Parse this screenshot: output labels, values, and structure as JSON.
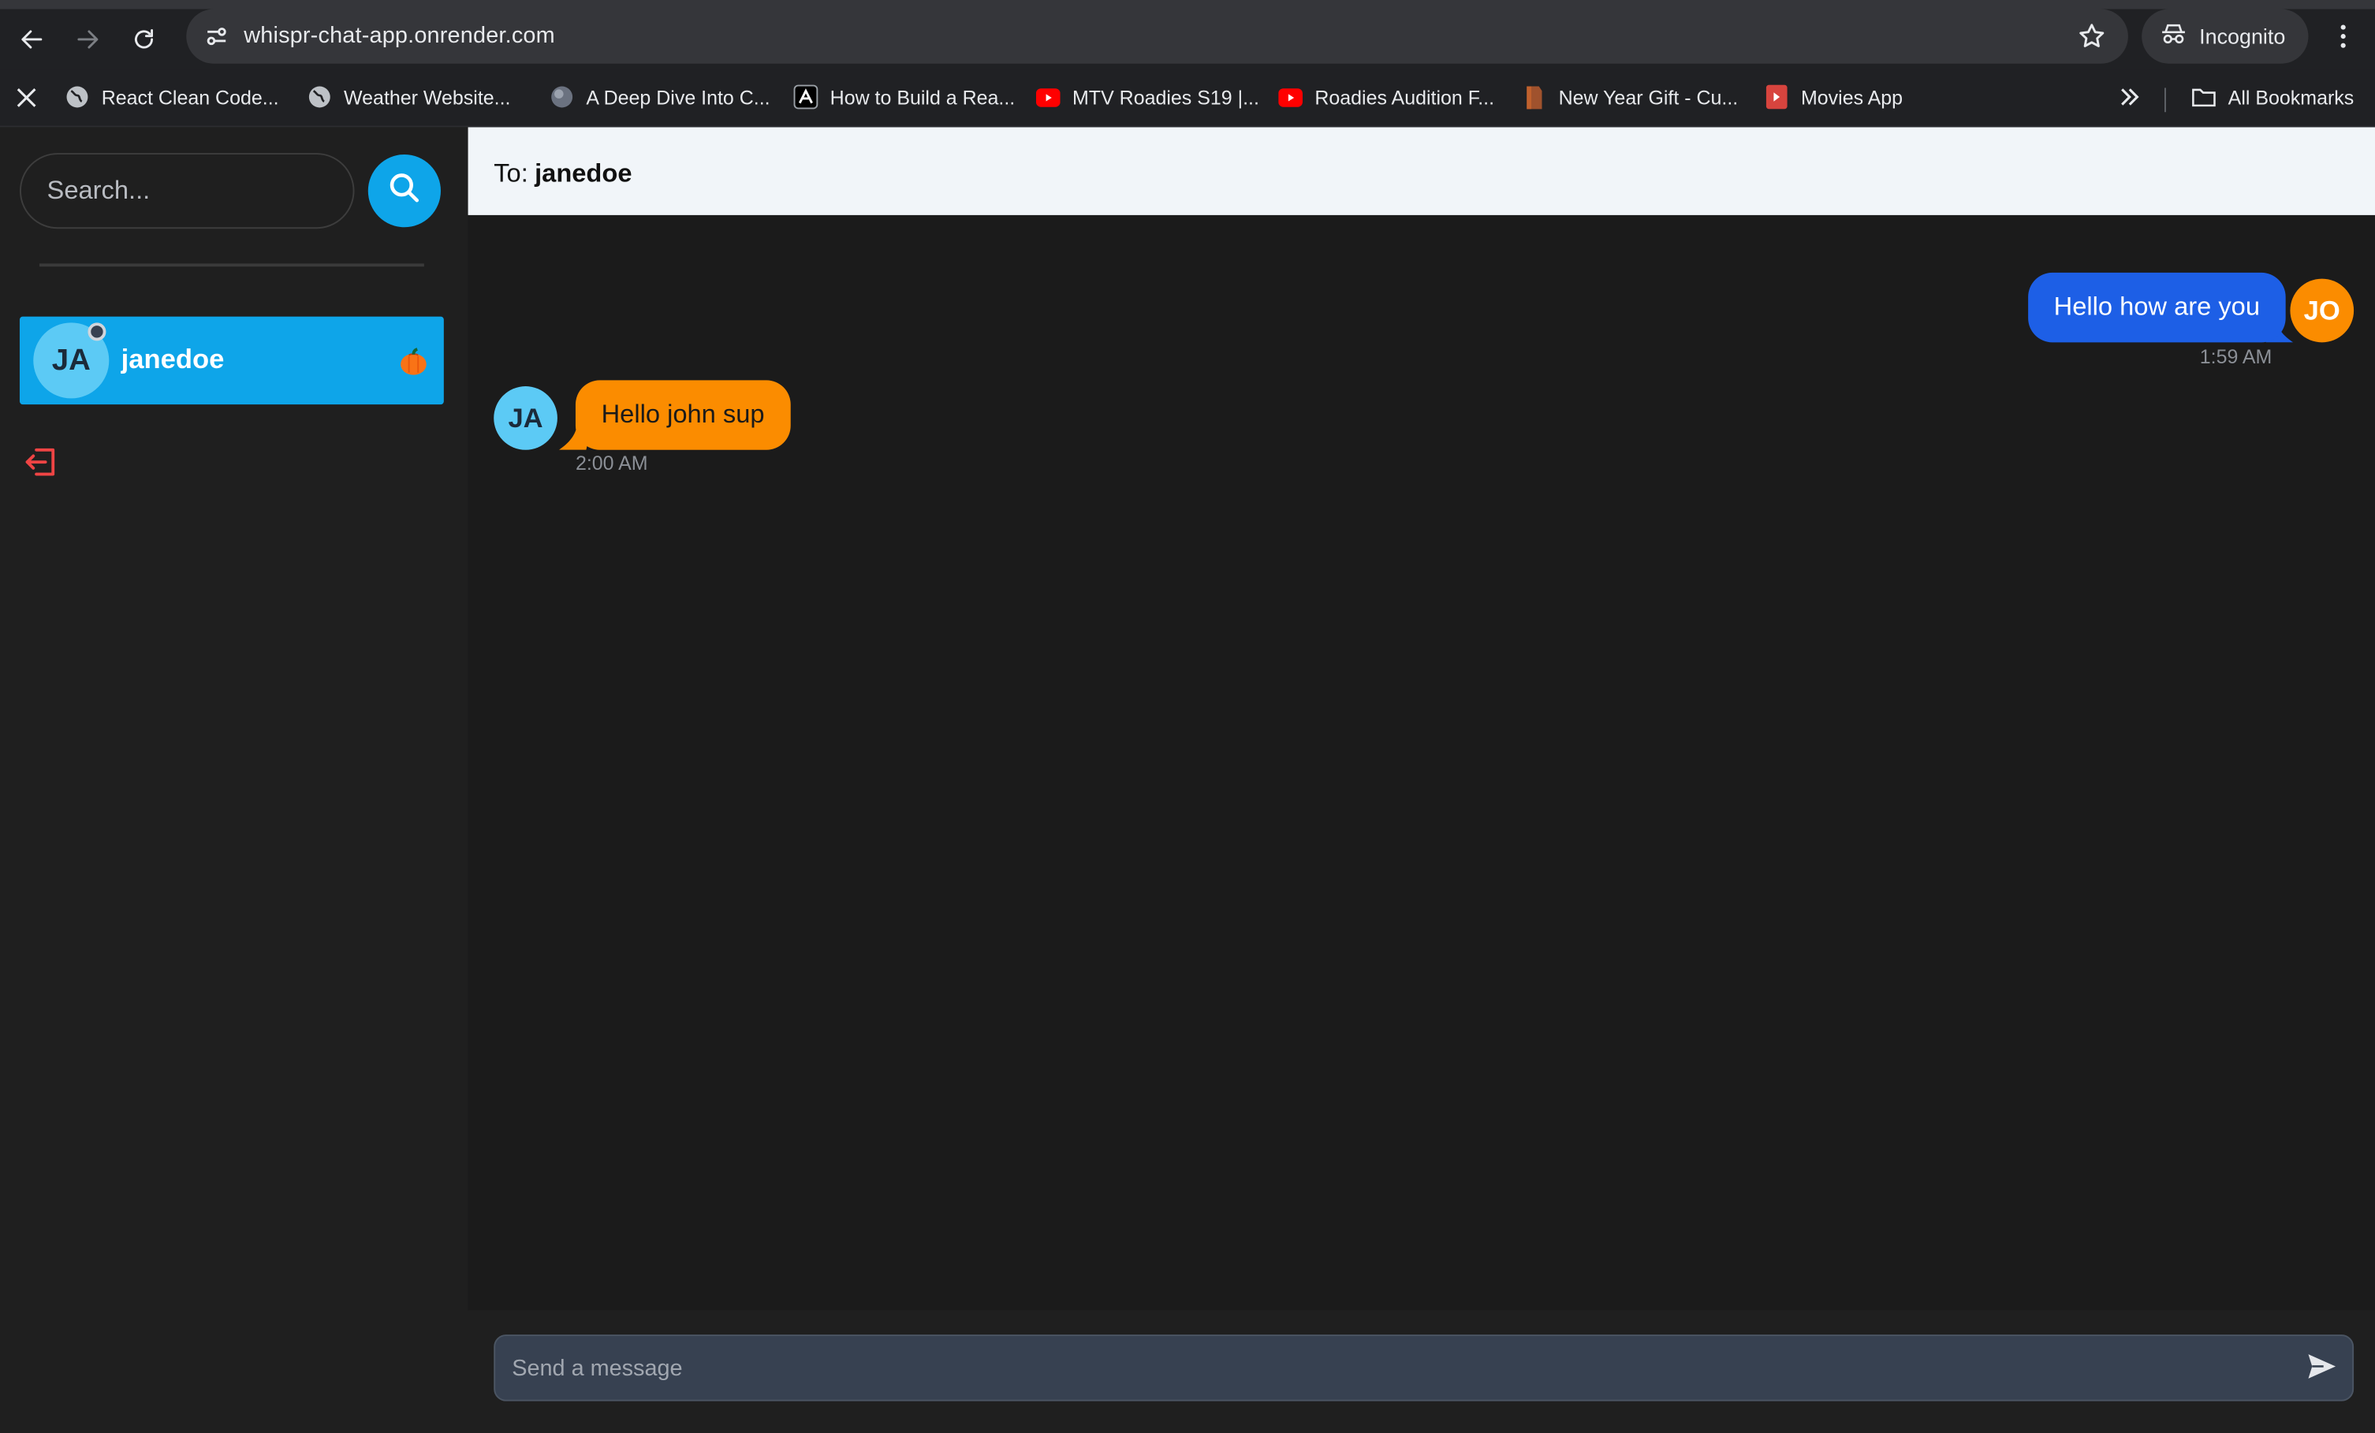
{
  "browser": {
    "url": "whispr-chat-app.onrender.com",
    "profile_label": "Incognito",
    "bookmarks": [
      {
        "label": "React Clean Code...",
        "icon": "globe-icon"
      },
      {
        "label": "Weather Website...",
        "icon": "globe-icon"
      },
      {
        "label": "A Deep Dive Into C...",
        "icon": "planet-icon"
      },
      {
        "label": "How to Build a Rea...",
        "icon": "vercel-a-icon"
      },
      {
        "label": "MTV Roadies S19 |...",
        "icon": "youtube-icon"
      },
      {
        "label": "Roadies Audition F...",
        "icon": "youtube-icon"
      },
      {
        "label": "New Year Gift - Cu...",
        "icon": "gift-icon"
      },
      {
        "label": "Movies App",
        "icon": "movie-icon"
      }
    ],
    "all_bookmarks_label": "All Bookmarks"
  },
  "sidebar": {
    "search_placeholder": "Search...",
    "conversations": [
      {
        "initials": "JA",
        "username": "janedoe",
        "emoji": "🎃",
        "online": true
      }
    ]
  },
  "chat": {
    "to_label": "To:",
    "recipient": "janedoe",
    "messages": [
      {
        "from": "me",
        "avatar": "JO",
        "text": "Hello how are you",
        "time": "1:59 AM"
      },
      {
        "from": "them",
        "avatar": "JA",
        "text": "Hello john sup",
        "time": "2:00 AM"
      }
    ],
    "input_placeholder": "Send a message"
  },
  "colors": {
    "accent": "#0ea5e9",
    "sent_bubble": "#1d5fe6",
    "received_bubble": "#fb8c00",
    "logout": "#ef4444"
  }
}
